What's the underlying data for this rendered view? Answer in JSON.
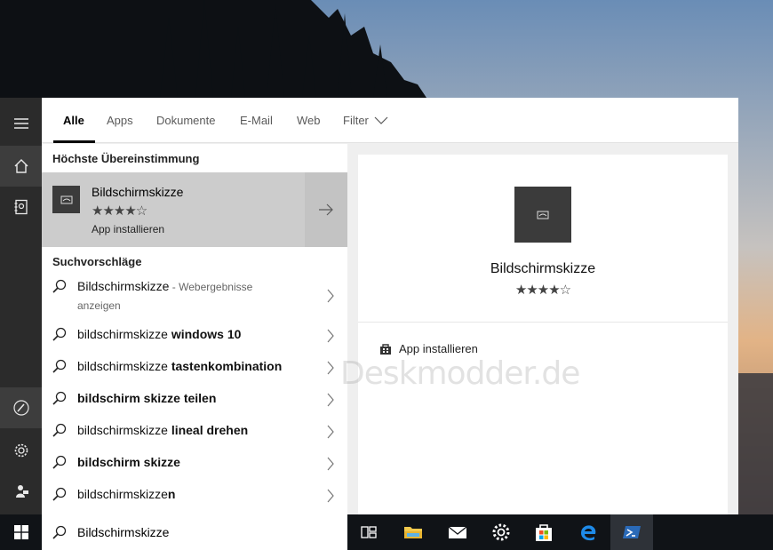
{
  "tabs": {
    "all": "Alle",
    "apps": "Apps",
    "documents": "Dokumente",
    "email": "E-Mail",
    "web": "Web",
    "filter": "Filter"
  },
  "best_match": {
    "heading": "Höchste Übereinstimmung",
    "title": "Bildschirmskizze",
    "rating_stars": "★★★★☆",
    "rating": 3.5,
    "subtitle": "App installieren"
  },
  "suggestions": {
    "heading": "Suchvorschläge",
    "items": [
      {
        "plain": "Bildschirmskizze",
        "bold": "",
        "muted": " - Webergebnisse anzeigen"
      },
      {
        "plain": "bildschirmskizze ",
        "bold": "windows 10",
        "muted": ""
      },
      {
        "plain": "bildschirmskizze ",
        "bold": "tastenkombination",
        "muted": ""
      },
      {
        "plain": "",
        "bold": "bildschirm skizze teilen",
        "muted": ""
      },
      {
        "plain": "bildschirmskizze ",
        "bold": "lineal drehen",
        "muted": ""
      },
      {
        "plain": "",
        "bold": "bildschirm skizze",
        "muted": ""
      },
      {
        "plain": "bildschirmskizze",
        "bold": "n",
        "muted": ""
      }
    ]
  },
  "preview": {
    "title": "Bildschirmskizze",
    "rating_stars": "★★★★☆",
    "action": "App installieren"
  },
  "watermark": "Deskmodder.de",
  "search": {
    "value": "Bildschirmskizze"
  },
  "colors": {
    "taskbar": "#101317",
    "rail": "#2b2b2b",
    "best_match_bg": "#cccccc",
    "edge_blue": "#0f78d7"
  }
}
